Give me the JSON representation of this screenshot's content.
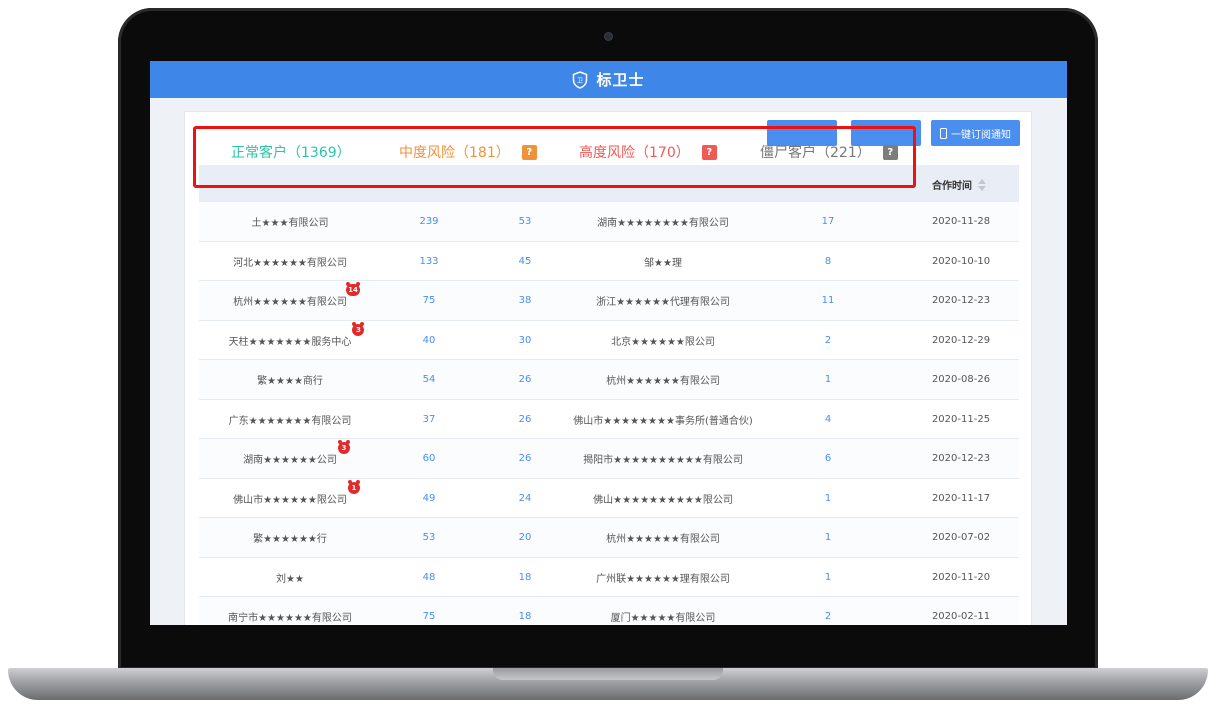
{
  "app": {
    "title": "标卫士"
  },
  "toolbar": {
    "button1": "",
    "button2": "",
    "subscribe": "一键订阅通知"
  },
  "stats": {
    "normal": "正常客户（1369）",
    "medium": "中度风险（181）",
    "high": "高度风险（170）",
    "zombie": "僵尸客户（221）",
    "help_glyph": "?"
  },
  "table": {
    "coop_time_header": "合作时间",
    "rows": [
      {
        "name": "土★★★有限公司",
        "n1": "239",
        "n2": "53",
        "agent": "湖南★★★★★★★★有限公司",
        "n3": "17",
        "date": "2020-11-28",
        "badge": ""
      },
      {
        "name": "河北★★★★★★有限公司",
        "n1": "133",
        "n2": "45",
        "agent": "邹★★理",
        "n3": "8",
        "date": "2020-10-10",
        "badge": ""
      },
      {
        "name": "杭州★★★★★★有限公司",
        "n1": "75",
        "n2": "38",
        "agent": "浙江★★★★★★代理有限公司",
        "n3": "11",
        "date": "2020-12-23",
        "badge": "14"
      },
      {
        "name": "天柱★★★★★★★服务中心",
        "n1": "40",
        "n2": "30",
        "agent": "北京★★★★★★限公司",
        "n3": "2",
        "date": "2020-12-29",
        "badge": "3"
      },
      {
        "name": "繁★★★★商行",
        "n1": "54",
        "n2": "26",
        "agent": "杭州★★★★★★有限公司",
        "n3": "1",
        "date": "2020-08-26",
        "badge": ""
      },
      {
        "name": "广东★★★★★★★有限公司",
        "n1": "37",
        "n2": "26",
        "agent": "佛山市★★★★★★★★事务所(普通合伙)",
        "n3": "4",
        "date": "2020-11-25",
        "badge": ""
      },
      {
        "name": "湖南★★★★★★公司",
        "n1": "60",
        "n2": "26",
        "agent": "揭阳市★★★★★★★★★★有限公司",
        "n3": "6",
        "date": "2020-12-23",
        "badge": "3"
      },
      {
        "name": "佛山市★★★★★★限公司",
        "n1": "49",
        "n2": "24",
        "agent": "佛山★★★★★★★★★★限公司",
        "n3": "1",
        "date": "2020-11-17",
        "badge": "1"
      },
      {
        "name": "繁★★★★★★行",
        "n1": "53",
        "n2": "20",
        "agent": "杭州★★★★★★有限公司",
        "n3": "1",
        "date": "2020-07-02",
        "badge": ""
      },
      {
        "name": "刘★★",
        "n1": "48",
        "n2": "18",
        "agent": "广州联★★★★★★理有限公司",
        "n3": "1",
        "date": "2020-11-20",
        "badge": ""
      },
      {
        "name": "南宁市★★★★★★有限公司",
        "n1": "75",
        "n2": "18",
        "agent": "厦门★★★★★有限公司",
        "n3": "2",
        "date": "2020-02-11",
        "badge": ""
      }
    ]
  },
  "colors": {
    "header_blue": "#3e86e8",
    "normal": "#2ec3a6",
    "medium": "#f0923a",
    "high": "#f05a55",
    "zombie": "#7d7d7d",
    "highlight": "#ee1111",
    "badge": "#e12b2b"
  },
  "icons": [
    "shield-logo-icon",
    "phone-icon",
    "question-icon",
    "sort-icon",
    "badge-icon"
  ]
}
